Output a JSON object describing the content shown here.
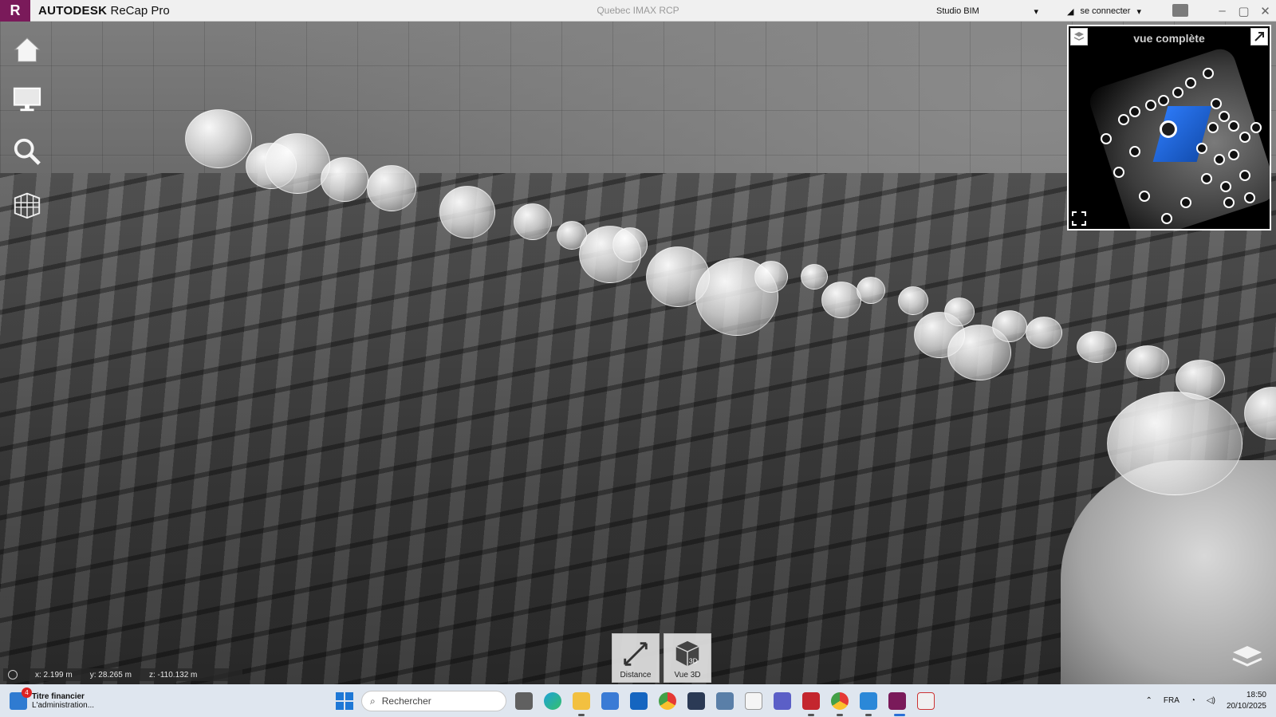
{
  "titlebar": {
    "logo_letter": "R",
    "brand": "AUTODESK",
    "product": "ReCap Pro",
    "document_title": "Quebec IMAX RCP",
    "workspace": "Studio  BIM",
    "signin_label": "se connecter",
    "window_controls": [
      "–",
      "▢",
      "✕"
    ]
  },
  "left_tools": [
    {
      "name": "home-icon"
    },
    {
      "name": "display-icon"
    },
    {
      "name": "search-icon"
    },
    {
      "name": "project-view-icon"
    }
  ],
  "minimap": {
    "title": "vue complète"
  },
  "coordinates": {
    "x": "x:  2.199 m",
    "y": "y:  28.265 m",
    "z": "z:  -110.132 m"
  },
  "bottom_tools": {
    "distance_label": "Distance",
    "view3d_label": "Vue 3D"
  },
  "taskbar": {
    "news_title": "Titre financier",
    "news_subtitle": "L'administration...",
    "news_badge": "4",
    "search_placeholder": "Rechercher",
    "language": "FRA",
    "time": "18:50",
    "date": "20/10/2025"
  },
  "colors": {
    "brand_accent": "#7a1a5a",
    "minimap_view": "#2a7bff",
    "taskbar_bg": "#dfe6ef"
  }
}
